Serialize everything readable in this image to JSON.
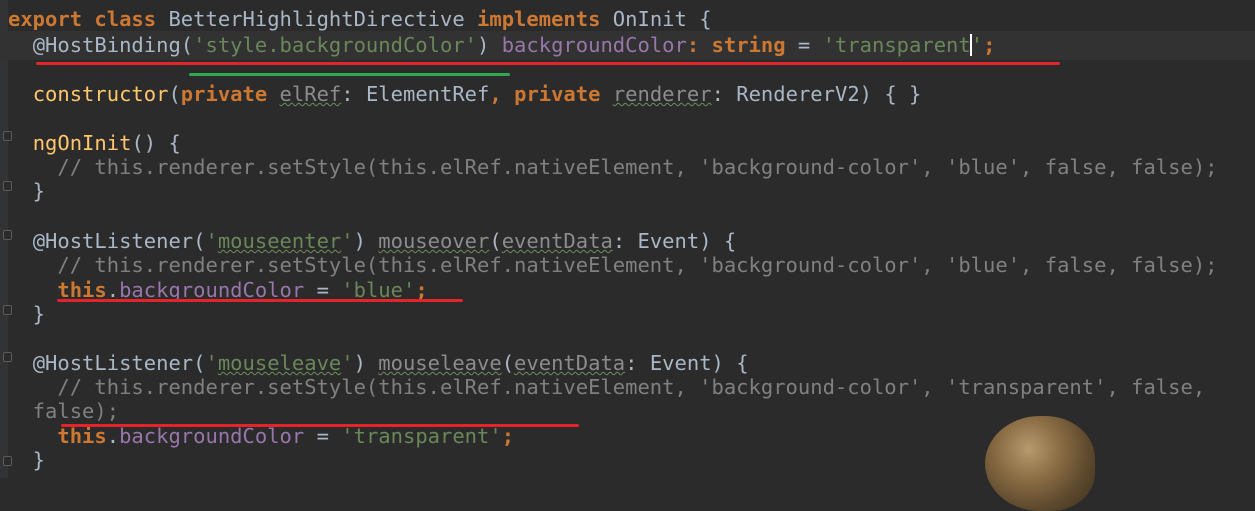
{
  "editor": {
    "lines": [
      {
        "id": "l1",
        "tokens": [
          {
            "t": "export",
            "c": "kw"
          },
          {
            "t": " ",
            "c": "plain"
          },
          {
            "t": "class",
            "c": "kw"
          },
          {
            "t": " BetterHighlightDirective ",
            "c": "plain"
          },
          {
            "t": "implements",
            "c": "kw"
          },
          {
            "t": " OnInit {",
            "c": "plain"
          }
        ]
      },
      {
        "id": "l2",
        "tokens": [
          {
            "t": "  ",
            "c": "plain"
          },
          {
            "t": "@HostBinding",
            "c": "plain"
          },
          {
            "t": "(",
            "c": "plain"
          },
          {
            "t": "'style.backgroundColor'",
            "c": "str"
          },
          {
            "t": ") ",
            "c": "plain"
          },
          {
            "t": "backgroundColor",
            "c": "field"
          },
          {
            "t": ": ",
            "c": "kw"
          },
          {
            "t": "string",
            "c": "kw"
          },
          {
            "t": " = ",
            "c": "plain"
          },
          {
            "t": "'transparent",
            "c": "str"
          },
          {
            "t": "",
            "c": "caret"
          },
          {
            "t": "'",
            "c": "str"
          },
          {
            "t": ";",
            "c": "kw"
          }
        ]
      },
      {
        "id": "l3",
        "tokens": []
      },
      {
        "id": "l4",
        "tokens": [
          {
            "t": "  ",
            "c": "plain"
          },
          {
            "t": "constructor",
            "c": "fn"
          },
          {
            "t": "(",
            "c": "plain"
          },
          {
            "t": "private",
            "c": "kw"
          },
          {
            "t": " ",
            "c": "plain"
          },
          {
            "t": "elRef",
            "c": "unused wavy"
          },
          {
            "t": ": ElementRef",
            "c": "plain"
          },
          {
            "t": ", ",
            "c": "kw"
          },
          {
            "t": "private",
            "c": "kw"
          },
          {
            "t": " ",
            "c": "plain"
          },
          {
            "t": "renderer",
            "c": "unused wavy"
          },
          {
            "t": ": RendererV2) { }",
            "c": "plain"
          }
        ]
      },
      {
        "id": "l5",
        "tokens": []
      },
      {
        "id": "l6",
        "tokens": [
          {
            "t": "  ",
            "c": "plain"
          },
          {
            "t": "ngOnInit",
            "c": "fn"
          },
          {
            "t": "() {",
            "c": "plain"
          }
        ]
      },
      {
        "id": "l7",
        "tokens": [
          {
            "t": "    // this.renderer.setStyle(this.elRef.nativeElement, 'background-color', 'blue', false, false);",
            "c": "cmt"
          }
        ]
      },
      {
        "id": "l8",
        "tokens": [
          {
            "t": "  }",
            "c": "plain"
          }
        ]
      },
      {
        "id": "l9",
        "tokens": []
      },
      {
        "id": "l10",
        "tokens": [
          {
            "t": "  ",
            "c": "plain"
          },
          {
            "t": "@HostListener",
            "c": "plain"
          },
          {
            "t": "(",
            "c": "plain"
          },
          {
            "t": "'",
            "c": "str"
          },
          {
            "t": "mouseenter",
            "c": "str wavy"
          },
          {
            "t": "'",
            "c": "str"
          },
          {
            "t": ") ",
            "c": "plain"
          },
          {
            "t": "mouseover",
            "c": "unused wavy"
          },
          {
            "t": "(",
            "c": "plain"
          },
          {
            "t": "eventData",
            "c": "unused wavy"
          },
          {
            "t": ": Event) {",
            "c": "plain"
          }
        ]
      },
      {
        "id": "l11",
        "tokens": [
          {
            "t": "    // this.renderer.setStyle(this.elRef.nativeElement, 'background-color', 'blue', false, false);",
            "c": "cmt"
          }
        ]
      },
      {
        "id": "l12",
        "tokens": [
          {
            "t": "    ",
            "c": "plain"
          },
          {
            "t": "this",
            "c": "kw"
          },
          {
            "t": ".",
            "c": "plain"
          },
          {
            "t": "backgroundColor",
            "c": "field"
          },
          {
            "t": " = ",
            "c": "plain"
          },
          {
            "t": "'blue'",
            "c": "str"
          },
          {
            "t": ";",
            "c": "kw"
          }
        ]
      },
      {
        "id": "l13",
        "tokens": [
          {
            "t": "  }",
            "c": "plain"
          }
        ]
      },
      {
        "id": "l14",
        "tokens": []
      },
      {
        "id": "l15",
        "tokens": [
          {
            "t": "  ",
            "c": "plain"
          },
          {
            "t": "@HostListener",
            "c": "plain"
          },
          {
            "t": "(",
            "c": "plain"
          },
          {
            "t": "'",
            "c": "str"
          },
          {
            "t": "mouseleave",
            "c": "str wavy"
          },
          {
            "t": "'",
            "c": "str"
          },
          {
            "t": ") ",
            "c": "plain"
          },
          {
            "t": "mouseleave",
            "c": "unused wavy"
          },
          {
            "t": "(",
            "c": "plain"
          },
          {
            "t": "eventData",
            "c": "unused wavy"
          },
          {
            "t": ": Event) {",
            "c": "plain"
          }
        ]
      },
      {
        "id": "l16",
        "tokens": [
          {
            "t": "    // this.renderer.setStyle(this.elRef.nativeElement, 'background-color', 'transparent', false,",
            "c": "cmt"
          }
        ]
      },
      {
        "id": "l17",
        "tokens": [
          {
            "t": "  false);",
            "c": "cmt"
          }
        ]
      },
      {
        "id": "l18",
        "tokens": [
          {
            "t": "    ",
            "c": "plain"
          },
          {
            "t": "this",
            "c": "kw"
          },
          {
            "t": ".",
            "c": "plain"
          },
          {
            "t": "backgroundColor",
            "c": "field"
          },
          {
            "t": " = ",
            "c": "plain"
          },
          {
            "t": "'transparent'",
            "c": "str"
          },
          {
            "t": ";",
            "c": "kw"
          }
        ]
      },
      {
        "id": "l19",
        "tokens": [
          {
            "t": "  }",
            "c": "plain"
          }
        ]
      }
    ]
  },
  "colors": {
    "background": "#2b2b2b",
    "keyword": "#cc7832",
    "string": "#6a8759",
    "field": "#9876aa",
    "function": "#ffc66d",
    "comment": "#808080",
    "text": "#a9b7c6",
    "annotation_red": "#e3242b",
    "annotation_green": "#2fa84f"
  }
}
